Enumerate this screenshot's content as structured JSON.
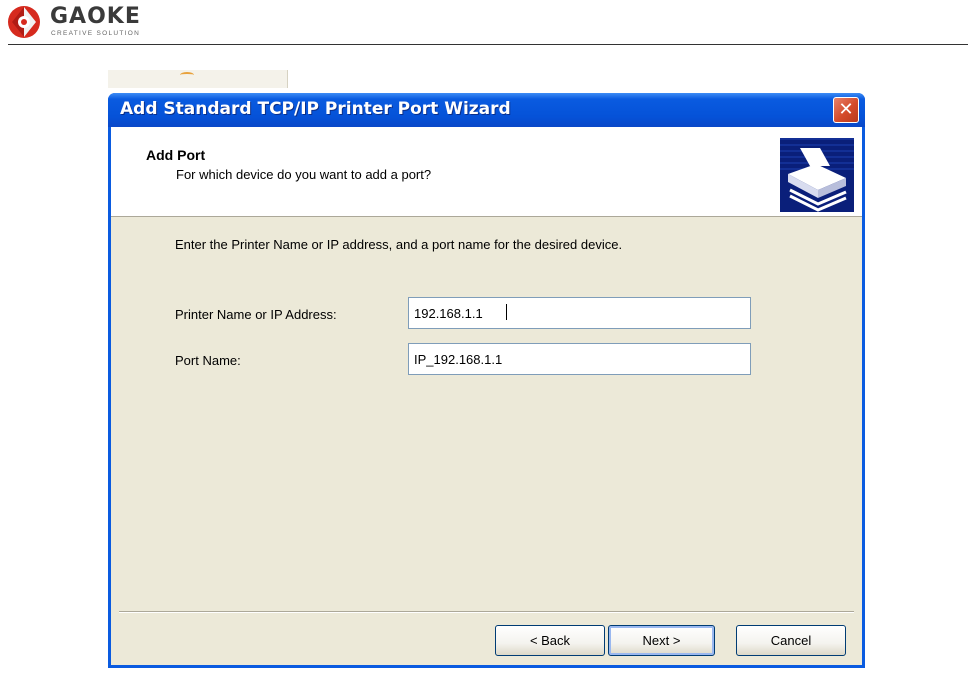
{
  "header": {
    "logo_word": "GAOKE",
    "logo_tagline": "CREATIVE SOLUTION",
    "icons": {
      "logo": "gaoke-logo-icon"
    }
  },
  "dialog": {
    "title": "Add Standard TCP/IP Printer Port Wizard",
    "close_glyph": "✕",
    "banner": {
      "title": "Add Port",
      "subtitle": "For which device do you want to add a port?",
      "icon": "printer-port-icon"
    },
    "instruction": "Enter the Printer Name or IP address, and a port name for the desired device.",
    "fields": [
      {
        "label": "Printer Name or IP Address:",
        "value": "192.168.1.1"
      },
      {
        "label": "Port Name:",
        "value": "IP_192.168.1.1"
      }
    ],
    "buttons": {
      "back": "< Back",
      "next": "Next >",
      "cancel": "Cancel"
    }
  },
  "colors": {
    "titlebar": "#0a5be0",
    "client": "#ece9d8",
    "close": "#d44a2a",
    "field_border": "#7f9db9"
  }
}
